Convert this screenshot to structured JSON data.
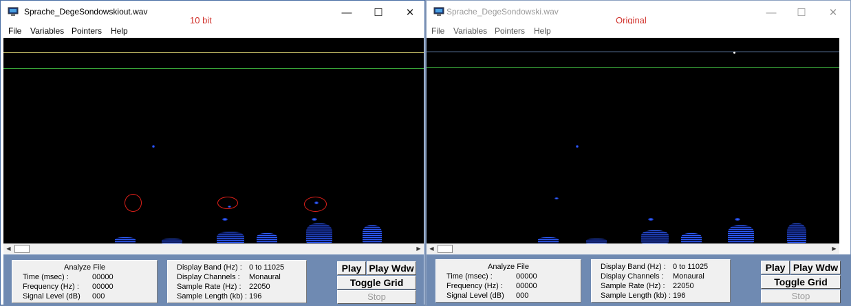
{
  "left": {
    "title": "Sprache_DegeSondowskiout.wav",
    "annotation": "10 bit",
    "menu": [
      "File",
      "Variables",
      "Pointers",
      "Help"
    ],
    "analyze": {
      "header": "Analyze File",
      "time_label": "Time (msec) :",
      "time_value": "00000",
      "freq_label": "Frequency (Hz) :",
      "freq_value": "00000",
      "level_label": "Signal Level (dB)",
      "level_value": "000"
    },
    "display": {
      "band_label": "Display Band (Hz) :",
      "band_value": "0 to 11025",
      "channels_label": "Display Channels :",
      "channels_value": "Monaural",
      "rate_label": "Sample Rate (Hz) :",
      "rate_value": "22050",
      "length_label": "Sample Length (kb) :",
      "length_value": "196"
    },
    "buttons": {
      "play": "Play",
      "play_wdw": "Play Wdw",
      "toggle_grid": "Toggle Grid",
      "stop": "Stop"
    }
  },
  "right": {
    "title": "Sprache_DegeSondowski.wav",
    "annotation": "Original",
    "menu": [
      "File",
      "Variables",
      "Pointers",
      "Help"
    ],
    "analyze": {
      "header": "Analyze File",
      "time_label": "Time (msec) :",
      "time_value": "00000",
      "freq_label": "Frequency (Hz) :",
      "freq_value": "00000",
      "level_label": "Signal Level (dB)",
      "level_value": "000"
    },
    "display": {
      "band_label": "Display Band (Hz) :",
      "band_value": "0 to 11025",
      "channels_label": "Display Channels :",
      "channels_value": "Monaural",
      "rate_label": "Sample Rate (Hz) :",
      "rate_value": "22050",
      "length_label": "Sample Length (kb) :",
      "length_value": "196"
    },
    "buttons": {
      "play": "Play",
      "play_wdw": "Play Wdw",
      "toggle_grid": "Toggle Grid",
      "stop": "Stop"
    }
  },
  "window_controls": {
    "minimize": "—",
    "maximize": "☐",
    "close": "✕"
  },
  "scroll_arrows": {
    "left": "◀",
    "right": "▶"
  },
  "colors": {
    "spectrogram_bg": "#000000",
    "signal": "#2f5fff",
    "upper_line": "#b8b060",
    "lower_line": "#3aa83a",
    "annotation": "#d0302a"
  }
}
